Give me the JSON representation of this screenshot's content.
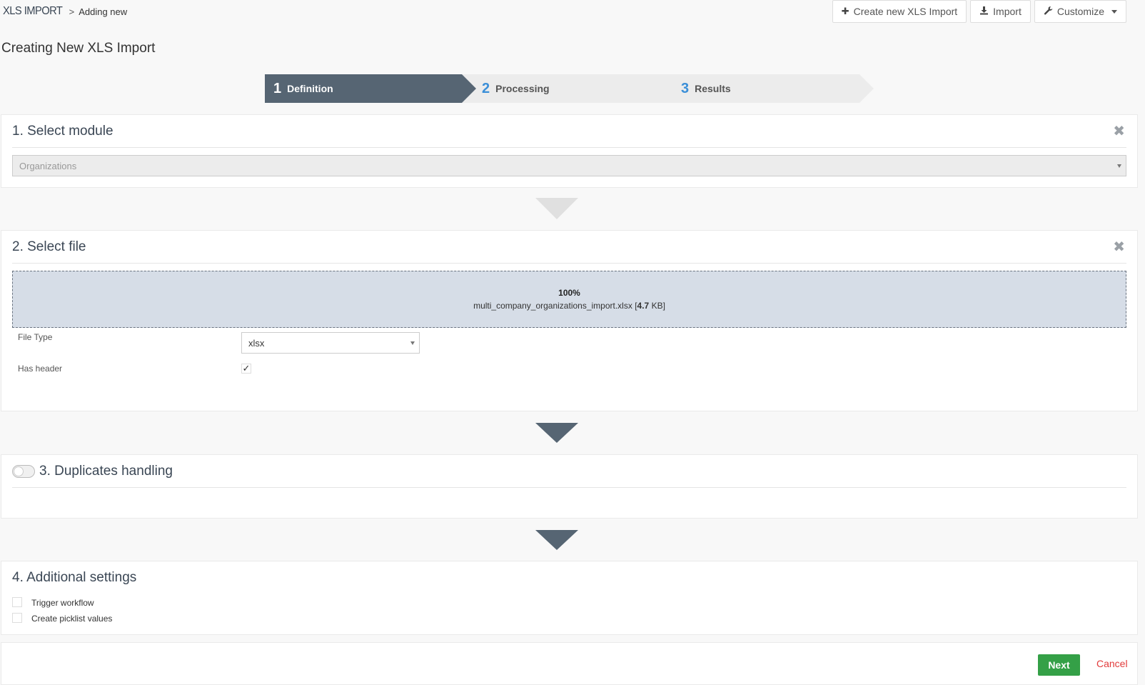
{
  "breadcrumb": {
    "module": "XLS IMPORT",
    "separator": ">",
    "current": "Adding new"
  },
  "toolbar": {
    "create_label": "Create new XLS Import",
    "import_label": "Import",
    "customize_label": "Customize"
  },
  "page": {
    "title": "Creating New XLS Import"
  },
  "wizard": {
    "steps": [
      {
        "num": "1",
        "label": "Definition",
        "active": true
      },
      {
        "num": "2",
        "label": "Processing",
        "active": false
      },
      {
        "num": "3",
        "label": "Results",
        "active": false
      }
    ]
  },
  "section1": {
    "title": "1. Select module",
    "module_value": "Organizations"
  },
  "section2": {
    "title": "2. Select file",
    "upload_progress": "100%",
    "file_name": "multi_company_organizations_import.xlsx",
    "file_size_open": "[",
    "file_size": "4.7",
    "file_size_unit": "KB]",
    "file_type_label": "File Type",
    "file_type_value": "xlsx",
    "has_header_label": "Has header",
    "has_header_checked": "✓"
  },
  "section3": {
    "title": "3. Duplicates handling"
  },
  "section4": {
    "title": "4. Additional settings",
    "trigger_workflow_label": "Trigger workflow",
    "create_picklist_label": "Create picklist values"
  },
  "footer": {
    "next_label": "Next",
    "cancel_label": "Cancel"
  },
  "colors": {
    "active_step": "#566573",
    "step_number": "#3b8fd8",
    "next_button": "#34a047",
    "cancel_link": "#e23b3b",
    "dropzone": "#d6dde7"
  },
  "icons": {
    "create": "plus-icon",
    "import": "download-icon",
    "customize": "wrench-icon",
    "close": "close-icon"
  }
}
